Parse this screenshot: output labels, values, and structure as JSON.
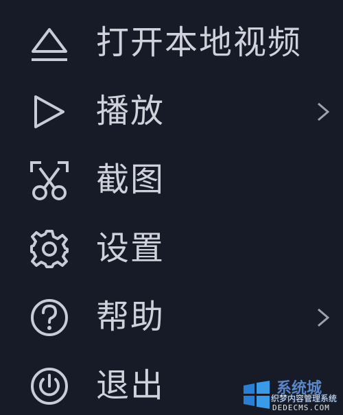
{
  "menu": {
    "items": [
      {
        "label": "打开本地视频",
        "icon": "eject-icon",
        "has_submenu": false
      },
      {
        "label": "播放",
        "icon": "play-icon",
        "has_submenu": true
      },
      {
        "label": "截图",
        "icon": "scissors-icon",
        "has_submenu": false
      },
      {
        "label": "设置",
        "icon": "gear-icon",
        "has_submenu": false
      },
      {
        "label": "帮助",
        "icon": "help-icon",
        "has_submenu": true
      },
      {
        "label": "退出",
        "icon": "power-icon",
        "has_submenu": false
      }
    ]
  },
  "watermark": {
    "top_text": "系统城",
    "cn_text": "织梦内容管理系统",
    "en_text": "DEDECMS.COM"
  },
  "colors": {
    "background": "#171b27",
    "text": "#cfd2da",
    "icon": "#c8ccd6",
    "watermark_blue": "#2a5fb0"
  }
}
